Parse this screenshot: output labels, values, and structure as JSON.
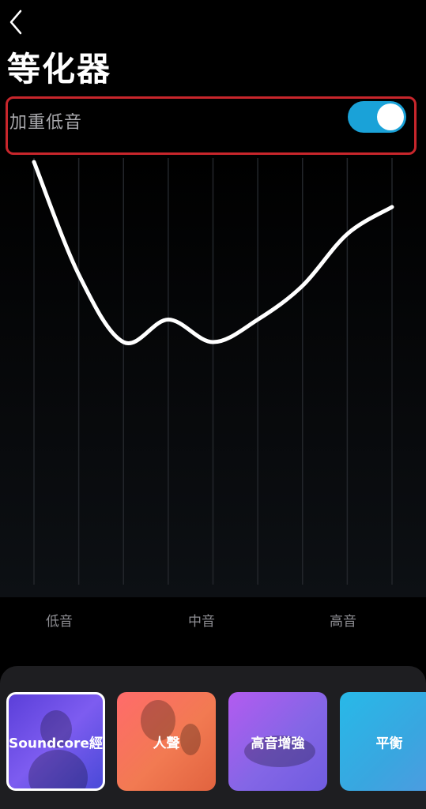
{
  "header": {
    "back_icon": "chevron-left-icon",
    "title": "等化器"
  },
  "bass_boost": {
    "label": "加重低音",
    "enabled": true,
    "toggle_color": "#1aa2d8"
  },
  "equalizer": {
    "band_labels": [
      "低音",
      "中音",
      "高音"
    ],
    "curve_color": "#ffffff",
    "band_count": 9,
    "band_levels": [
      1.0,
      0.5,
      0.2,
      0.3,
      0.2,
      0.3,
      0.45,
      0.68,
      0.8
    ]
  },
  "presets": {
    "items": [
      {
        "label": "Soundcore經典",
        "selected": true
      },
      {
        "label": "人聲",
        "selected": false
      },
      {
        "label": "高音增強",
        "selected": false
      },
      {
        "label": "平衡",
        "selected": false
      }
    ]
  }
}
